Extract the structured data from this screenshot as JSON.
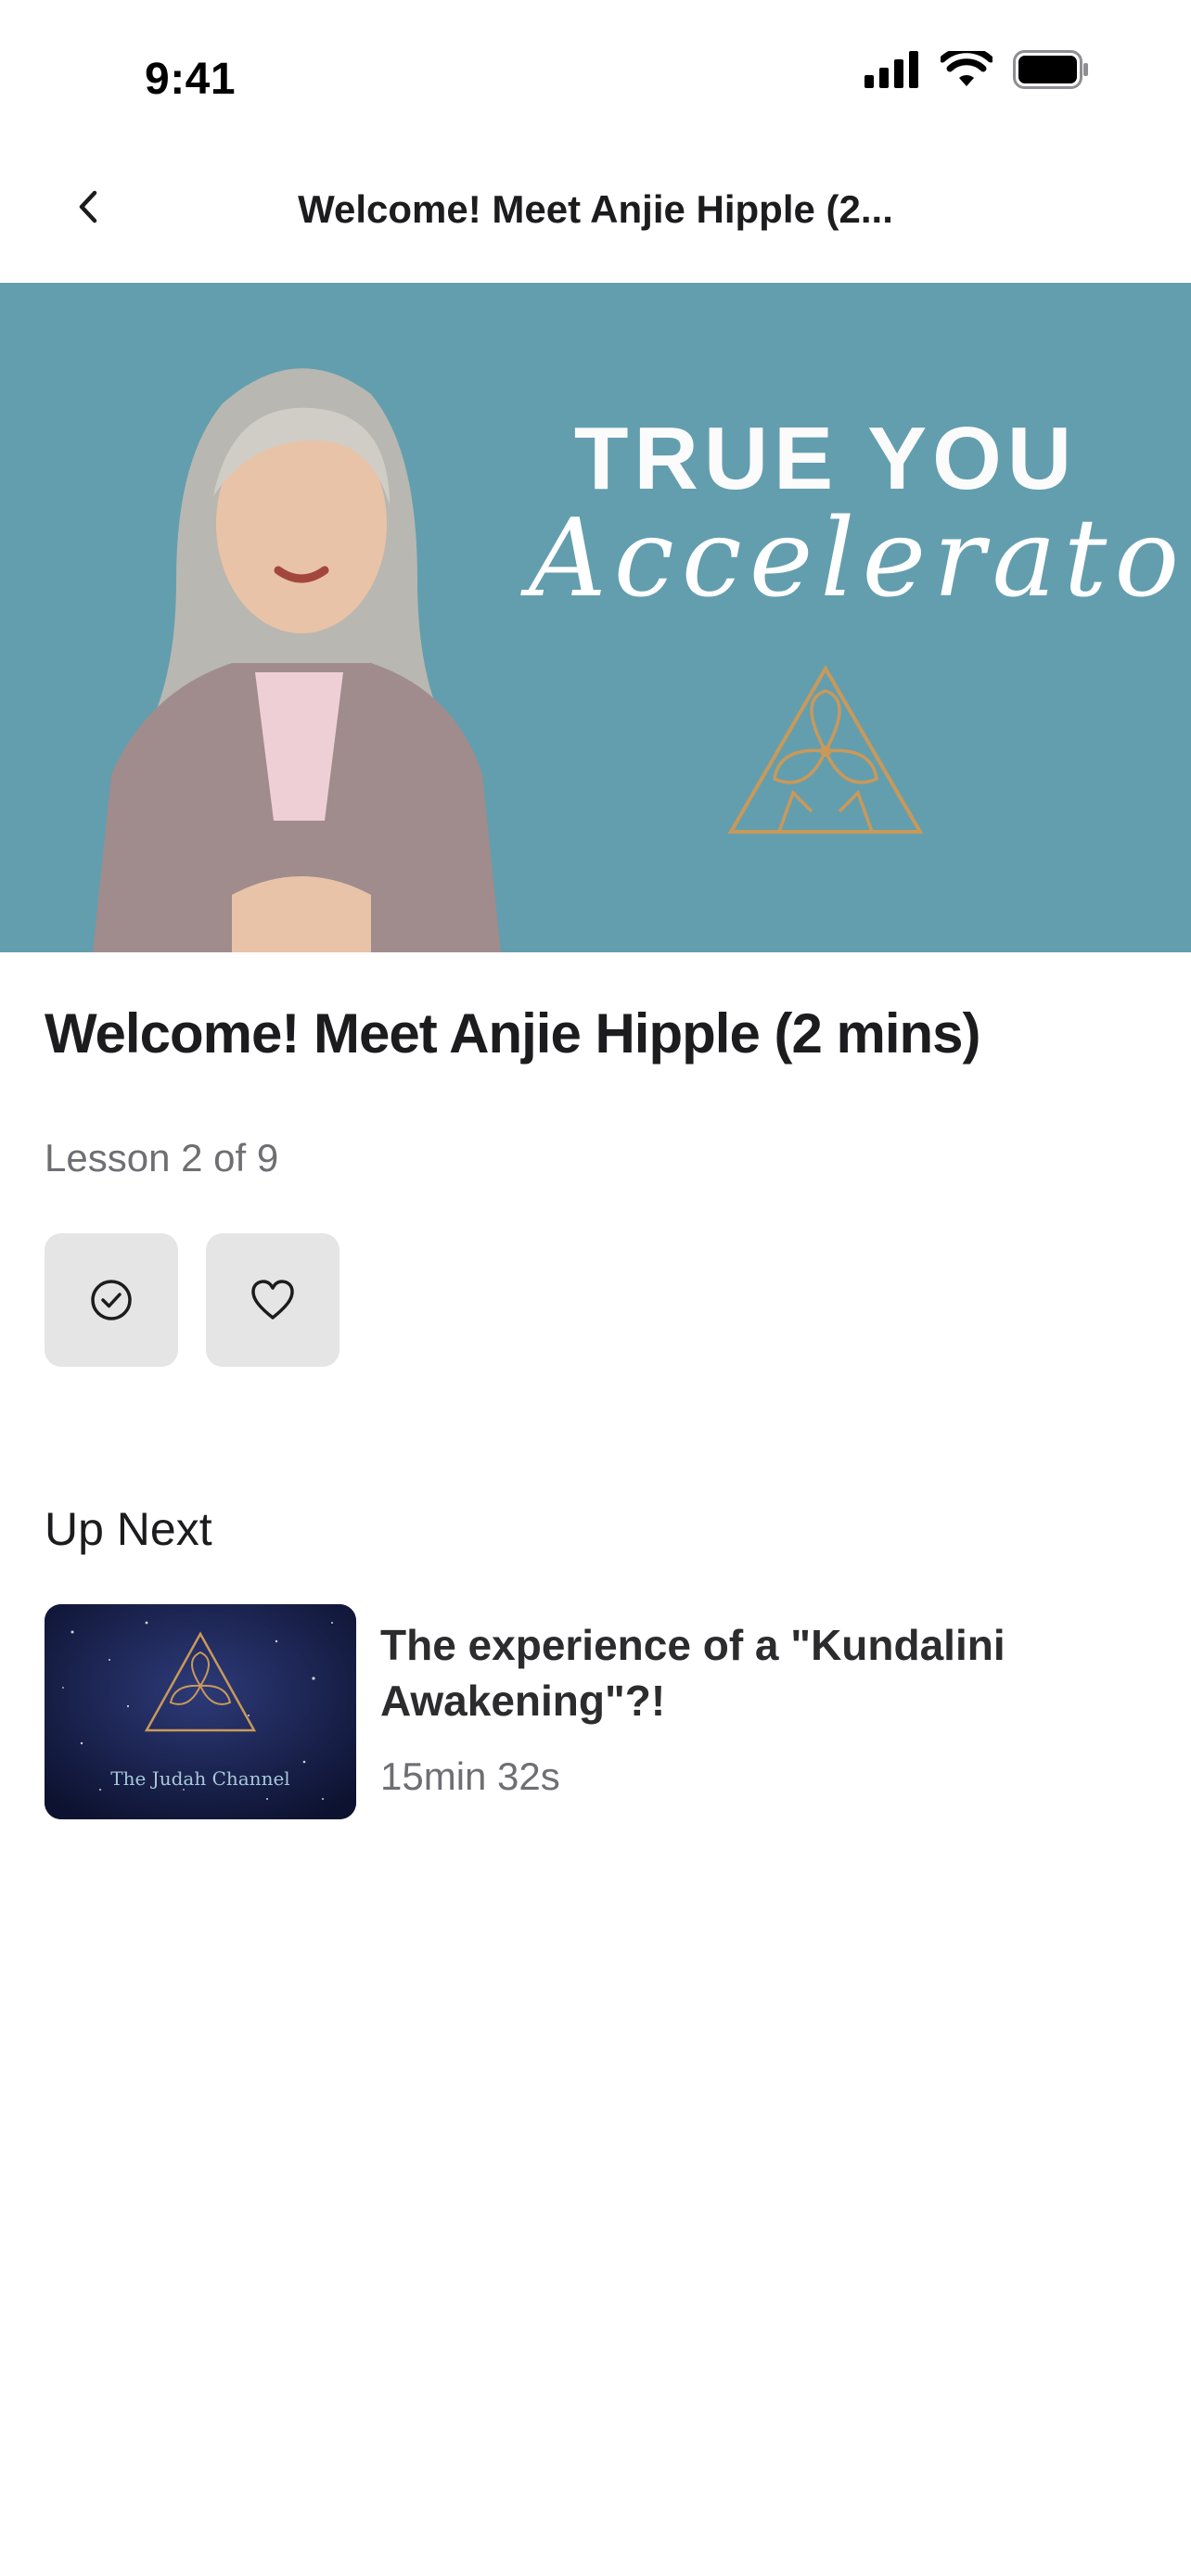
{
  "status_bar": {
    "time": "9:41",
    "icons": [
      "cellular-signal-icon",
      "wifi-icon",
      "battery-icon"
    ]
  },
  "nav": {
    "title": "Welcome! Meet Anjie Hipple (2...",
    "back_icon": "chevron-left-icon"
  },
  "hero": {
    "title_line1": "TRUE YOU",
    "title_line2": "Accelerator",
    "background_color": "#639eae",
    "accent_color": "#c9995a"
  },
  "lesson": {
    "title": "Welcome! Meet Anjie Hipple (2 mins)",
    "progress": "Lesson 2 of 9",
    "actions": [
      {
        "name": "mark-complete-button",
        "icon": "check-circle-icon"
      },
      {
        "name": "favorite-button",
        "icon": "heart-icon"
      }
    ]
  },
  "up_next": {
    "heading": "Up Next",
    "items": [
      {
        "title": "The experience of a \"Kundalini Awakening\"?!",
        "duration": "15min 32s",
        "thumbnail_caption": "The Judah Channel"
      }
    ]
  }
}
